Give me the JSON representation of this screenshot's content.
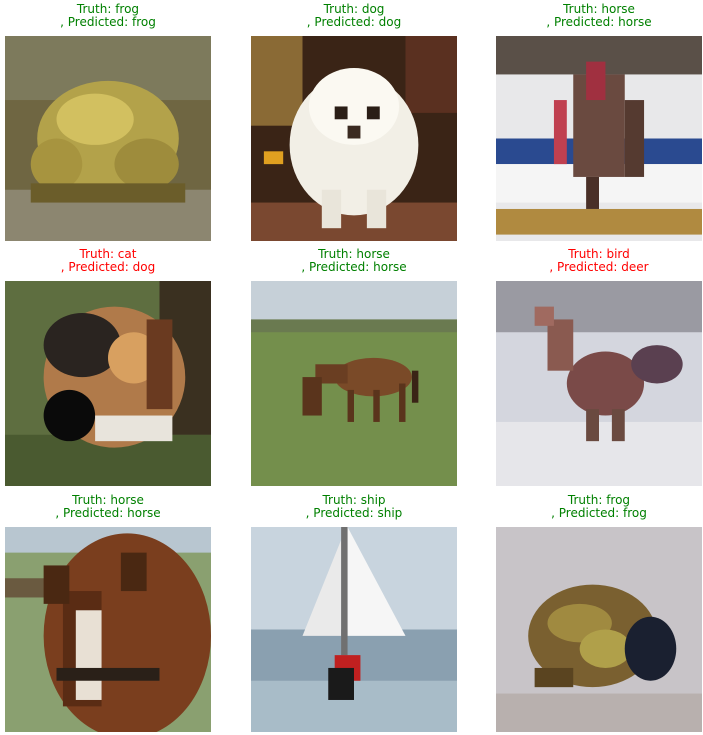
{
  "status_colors": {
    "correct": "#008000",
    "wrong": "#ff0000"
  },
  "samples": [
    {
      "truth": "Truth: frog",
      "pred": ", Predicted: frog",
      "correct": true,
      "image": "frog-icon"
    },
    {
      "truth": "Truth: dog",
      "pred": ", Predicted: dog",
      "correct": true,
      "image": "dog-icon"
    },
    {
      "truth": "Truth: horse",
      "pred": ", Predicted: horse",
      "correct": true,
      "image": "horse-rider-icon"
    },
    {
      "truth": "Truth: cat",
      "pred": ", Predicted: dog",
      "correct": false,
      "image": "cat-icon"
    },
    {
      "truth": "Truth: horse",
      "pred": ", Predicted: horse",
      "correct": true,
      "image": "horse-grazing-icon"
    },
    {
      "truth": "Truth: bird",
      "pred": ", Predicted: deer",
      "correct": false,
      "image": "bird-icon"
    },
    {
      "truth": "Truth: horse",
      "pred": ", Predicted: horse",
      "correct": true,
      "image": "horse-head-icon"
    },
    {
      "truth": "Truth: ship",
      "pred": ", Predicted: ship",
      "correct": true,
      "image": "sailboat-icon"
    },
    {
      "truth": "Truth: frog",
      "pred": ", Predicted: frog",
      "correct": true,
      "image": "frog-icon"
    }
  ]
}
